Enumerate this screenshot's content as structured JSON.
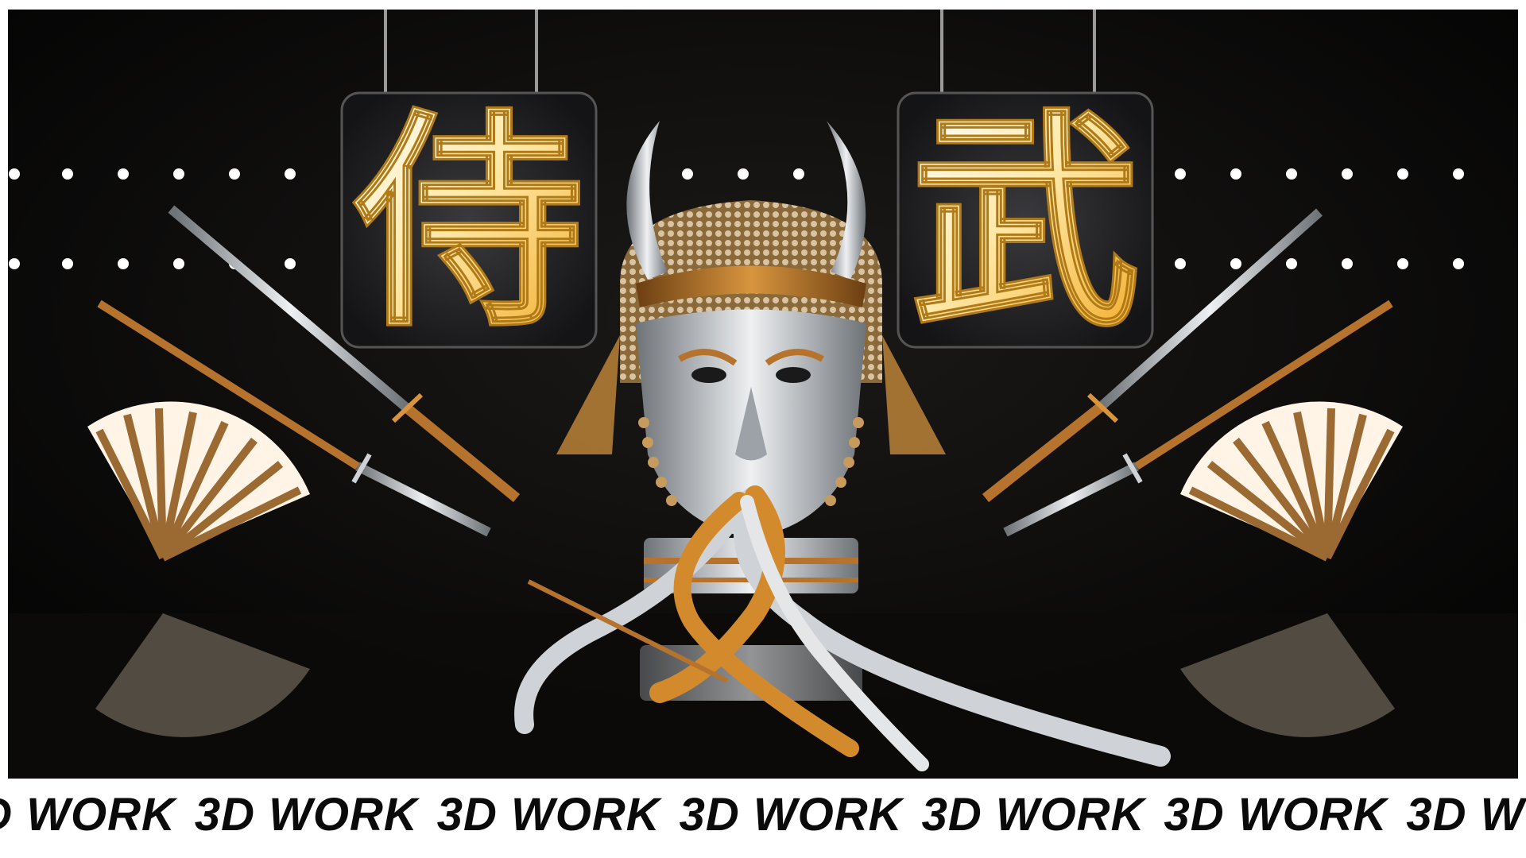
{
  "scene": {
    "kanji_left": "侍",
    "kanji_right": "武",
    "colors": {
      "background": "#050505",
      "gold": "#f3b535",
      "gold_dark": "#b07a18",
      "silver": "#cfd3d8",
      "copper": "#b5732e",
      "light": "#ffffff"
    }
  },
  "marquee": {
    "items": [
      "3D WORK",
      "3D WORK",
      "3D WORK",
      "3D WORK",
      "3D WORK",
      "3D WORK",
      "3D WORK"
    ]
  }
}
